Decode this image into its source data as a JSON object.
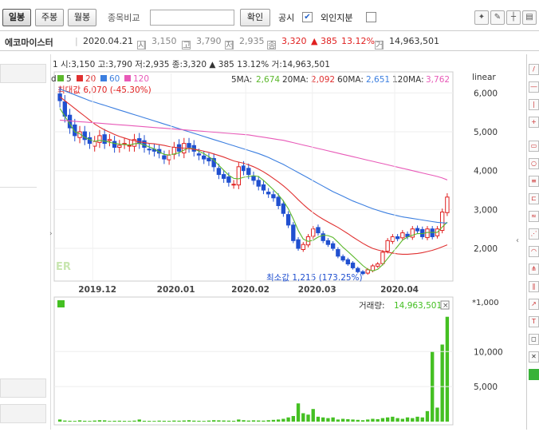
{
  "toolbar": {
    "tabs": [
      {
        "label": "일봉",
        "active": true
      },
      {
        "label": "주봉",
        "active": false
      },
      {
        "label": "월봉",
        "active": false
      }
    ],
    "compare_label": "종목비교",
    "compare_placeholder": "",
    "confirm_label": "확인",
    "notice_label": "공시",
    "notice_checked": true,
    "foreign_label": "외인지분",
    "foreign_checked": false
  },
  "info": {
    "name": "에코마이스터",
    "date": "2020.04.21",
    "open_icon": "시",
    "open": "3,150",
    "high_icon": "고",
    "high": "3,790",
    "low_icon": "저",
    "low": "2,935",
    "close_icon": "종",
    "close": "3,320",
    "change_arrow": "▲",
    "change": "385",
    "change_pct": "13.12%",
    "volume_icon": "거",
    "volume": "14,963,501"
  },
  "chart_header": "1 시:3,150 고:3,790 저:2,935 종:3,320 ▲  385  13.12% 거:14,963,501",
  "legend": {
    "items": [
      {
        "label": "5",
        "color": "#5cb82c"
      },
      {
        "label": "20",
        "color": "#e03030"
      },
      {
        "label": "60",
        "color": "#3c7fe0"
      },
      {
        "label": "120",
        "color": "#e85ab8"
      }
    ],
    "ma5_label": "5MA:",
    "ma5": "2,674",
    "ma20_label": "20MA:",
    "ma20": "2,092",
    "ma60_label": "60MA:",
    "ma60": "2,651",
    "ma120_label": "120MA:",
    "ma120": "3,762",
    "scale": "linear"
  },
  "annotations": {
    "max": "최대값 6,070 (-45.30%)",
    "min": "최소값 1,215 (173.25%)",
    "watermark": "ER"
  },
  "volume_panel": {
    "label": "거래량:",
    "value": "14,963,501",
    "unit": "*1,000",
    "close_icon": "×"
  },
  "colors": {
    "up": "#e02020",
    "down": "#2050d0",
    "ma5": "#5cb82c",
    "ma20": "#e03030",
    "ma60": "#3c7fe0",
    "ma120": "#e85ab8",
    "volume": "#44c022"
  },
  "chart_data": [
    {
      "type": "candlestick",
      "title": "",
      "x_tick_labels": [
        "2019.12",
        "2020.01",
        "2020.02",
        "2020.03",
        "2020.04"
      ],
      "y_tick_labels": [
        "6,000",
        "5,000",
        "4,000",
        "3,000",
        "2,000"
      ],
      "ylim": [
        1200,
        6500
      ],
      "y_scale": "linear",
      "series": [
        {
          "name": "price",
          "close": [
            5800,
            5400,
            5100,
            4900,
            5000,
            4800,
            4700,
            4750,
            4900,
            4700,
            4800,
            4600,
            4650,
            4700,
            4650,
            4800,
            4700,
            4600,
            4550,
            4500,
            4450,
            4300,
            4400,
            4600,
            4500,
            4700,
            4600,
            4500,
            4400,
            4300,
            4250,
            4100,
            3900,
            3800,
            3700,
            3650,
            4100,
            4000,
            3900,
            3750,
            3600,
            3500,
            3400,
            3300,
            3100,
            2900,
            2600,
            2200,
            2000,
            2100,
            2300,
            2500,
            2400,
            2200,
            2100,
            2000,
            1800,
            1700,
            1600,
            1500,
            1400,
            1350,
            1450,
            1550,
            1600,
            1900,
            2200,
            2300,
            2250,
            2400,
            2300,
            2500,
            2450,
            2300,
            2500,
            2300,
            2500,
            2935,
            3320
          ]
        },
        {
          "name": "5",
          "values": [
            5600,
            5400,
            5200,
            5000,
            4950,
            4850,
            4800,
            4750,
            4780,
            4760,
            4730,
            4700,
            4680,
            4670,
            4660,
            4690,
            4700,
            4660,
            4610,
            4560,
            4480,
            4420,
            4400,
            4430,
            4460,
            4530,
            4580,
            4560,
            4500,
            4440,
            4360,
            4270,
            4140,
            4010,
            3880,
            3800,
            3790,
            3830,
            3850,
            3870,
            3850,
            3750,
            3630,
            3510,
            3380,
            3220,
            3020,
            2760,
            2460,
            2240,
            2180,
            2210,
            2290,
            2340,
            2330,
            2280,
            2160,
            2030,
            1920,
            1800,
            1680,
            1560,
            1460,
            1420,
            1460,
            1580,
            1740,
            1900,
            2050,
            2210,
            2290,
            2340,
            2380,
            2380,
            2410,
            2410,
            2410,
            2550,
            2674
          ]
        },
        {
          "name": "20",
          "values": [
            5900,
            5800,
            5700,
            5600,
            5500,
            5400,
            5300,
            5200,
            5120,
            5050,
            4990,
            4930,
            4880,
            4840,
            4800,
            4770,
            4740,
            4720,
            4700,
            4690,
            4670,
            4650,
            4620,
            4600,
            4590,
            4580,
            4570,
            4550,
            4530,
            4500,
            4470,
            4430,
            4390,
            4350,
            4300,
            4250,
            4220,
            4190,
            4150,
            4100,
            4040,
            3970,
            3890,
            3800,
            3710,
            3610,
            3500,
            3380,
            3250,
            3130,
            3020,
            2920,
            2830,
            2750,
            2680,
            2610,
            2540,
            2460,
            2380,
            2290,
            2210,
            2130,
            2060,
            2000,
            1960,
            1930,
            1900,
            1880,
            1860,
            1850,
            1850,
            1860,
            1870,
            1890,
            1920,
            1950,
            1990,
            2040,
            2092
          ]
        },
        {
          "name": "60",
          "values": [
            6100,
            6050,
            6000,
            5950,
            5900,
            5850,
            5800,
            5760,
            5720,
            5680,
            5640,
            5600,
            5560,
            5520,
            5480,
            5440,
            5400,
            5360,
            5320,
            5280,
            5240,
            5200,
            5160,
            5120,
            5080,
            5040,
            5000,
            4960,
            4920,
            4880,
            4840,
            4800,
            4760,
            4720,
            4680,
            4640,
            4600,
            4560,
            4520,
            4480,
            4440,
            4390,
            4340,
            4280,
            4220,
            4160,
            4090,
            4020,
            3950,
            3880,
            3810,
            3740,
            3670,
            3600,
            3530,
            3460,
            3400,
            3340,
            3280,
            3220,
            3170,
            3120,
            3070,
            3020,
            2980,
            2940,
            2900,
            2870,
            2840,
            2810,
            2790,
            2770,
            2750,
            2730,
            2710,
            2690,
            2670,
            2660,
            2651
          ]
        },
        {
          "name": "120",
          "values": [
            5300,
            5290,
            5280,
            5270,
            5260,
            5250,
            5240,
            5230,
            5220,
            5210,
            5200,
            5190,
            5180,
            5170,
            5160,
            5150,
            5140,
            5130,
            5120,
            5110,
            5100,
            5090,
            5080,
            5070,
            5060,
            5050,
            5040,
            5030,
            5020,
            5010,
            5000,
            4990,
            4980,
            4970,
            4960,
            4950,
            4940,
            4930,
            4920,
            4900,
            4880,
            4860,
            4840,
            4820,
            4800,
            4780,
            4750,
            4720,
            4690,
            4660,
            4630,
            4600,
            4570,
            4540,
            4510,
            4480,
            4450,
            4420,
            4390,
            4360,
            4330,
            4300,
            4270,
            4240,
            4210,
            4180,
            4150,
            4120,
            4090,
            4060,
            4030,
            4000,
            3970,
            3940,
            3910,
            3880,
            3850,
            3810,
            3762
          ]
        }
      ]
    },
    {
      "type": "bar",
      "title": "",
      "ylabel": "*1,000",
      "y_tick_labels": [
        "10,000",
        "5,000"
      ],
      "ylim": [
        0,
        15500
      ],
      "series": [
        {
          "name": "거래량",
          "values": [
            300,
            150,
            120,
            100,
            180,
            120,
            100,
            150,
            200,
            180,
            100,
            120,
            130,
            110,
            100,
            140,
            300,
            120,
            110,
            100,
            140,
            120,
            110,
            150,
            130,
            160,
            200,
            140,
            120,
            100,
            150,
            200,
            180,
            160,
            140,
            120,
            300,
            200,
            150,
            180,
            160,
            140,
            200,
            250,
            300,
            400,
            600,
            800,
            2600,
            1200,
            1000,
            1800,
            700,
            600,
            500,
            600,
            300,
            400,
            350,
            300,
            250,
            200,
            300,
            400,
            350,
            500,
            600,
            700,
            500,
            400,
            600,
            500,
            700,
            600,
            1500,
            10000,
            2000,
            11000,
            14963
          ]
        }
      ]
    }
  ]
}
